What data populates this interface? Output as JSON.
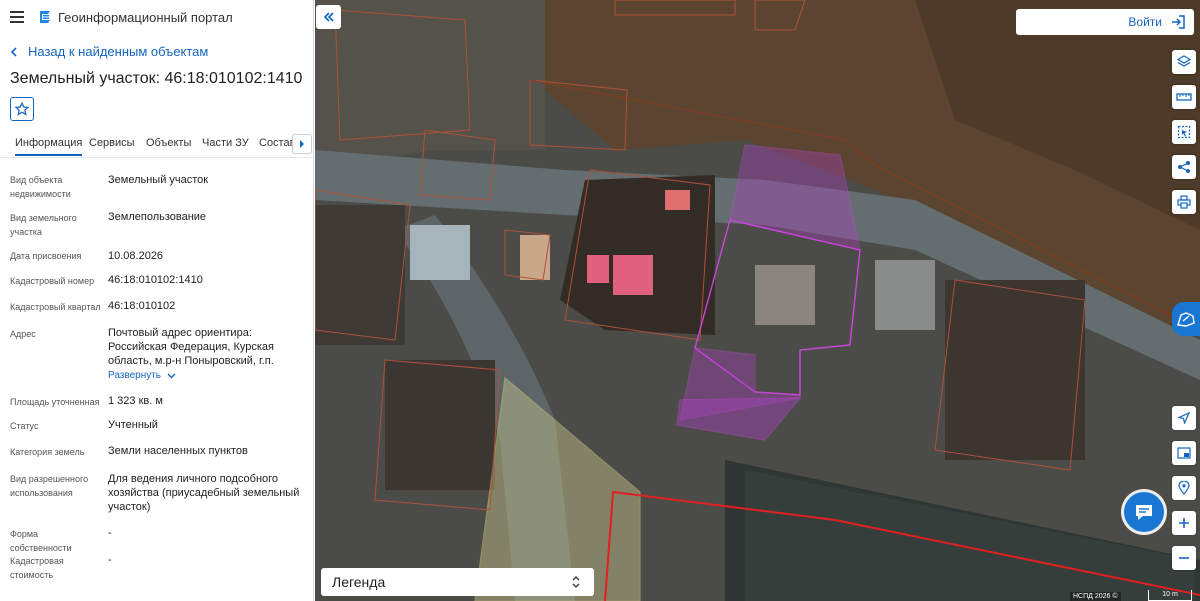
{
  "app": {
    "title": "Геоинформационный портал"
  },
  "nav": {
    "back_label": "Назад к найденным объектам"
  },
  "object": {
    "title": "Земельный участок: 46:18:010102:1410"
  },
  "tabs": [
    "Информация",
    "Сервисы",
    "Объекты",
    "Части ЗУ",
    "Состав"
  ],
  "info_rows": [
    {
      "label": "Вид объекта недвижимости",
      "value": "Земельный участок"
    },
    {
      "label": "Вид земельного участка",
      "value": "Землепользование"
    },
    {
      "label": "Дата присвоения",
      "value": "10.08.2026"
    },
    {
      "label": "Кадастровый номер",
      "value": "46:18:010102:1410"
    },
    {
      "label": "Кадастровый квартал",
      "value": "46:18:010102"
    },
    {
      "label": "Адрес",
      "value": "Почтовый адрес ориентира: Российская Федерация, Курская область, м.р-н Поныровский, г.п."
    },
    {
      "label": "Площадь уточненная",
      "value": "1 323 кв. м"
    },
    {
      "label": "Статус",
      "value": "Учтенный"
    },
    {
      "label": "Категория земель",
      "value": "Земли населенных пунктов"
    },
    {
      "label": "Вид разрешенного использования",
      "value": "Для ведения личного подсобного хозяйства (приусадебный земельный участок)"
    },
    {
      "label": "Форма собственности",
      "value": "-"
    },
    {
      "label": "Кадастровая стоимость",
      "value": "-"
    }
  ],
  "address_expand_label": "Развернуть",
  "map": {
    "login_label": "Войти",
    "legend_label": "Легенда",
    "attribution": "НСПД 2026 ©",
    "scale_label": "10 m",
    "icons": [
      "layers-icon",
      "ruler-icon",
      "select-area-icon",
      "share-icon",
      "print-icon",
      "locate-icon",
      "basemap-icon",
      "pin-icon",
      "zoom-in-icon",
      "zoom-out-icon",
      "chat-icon"
    ]
  },
  "colors": {
    "accent": "#1565c0",
    "selected_parcel": "#b040c8",
    "boundary": "#e02020"
  }
}
